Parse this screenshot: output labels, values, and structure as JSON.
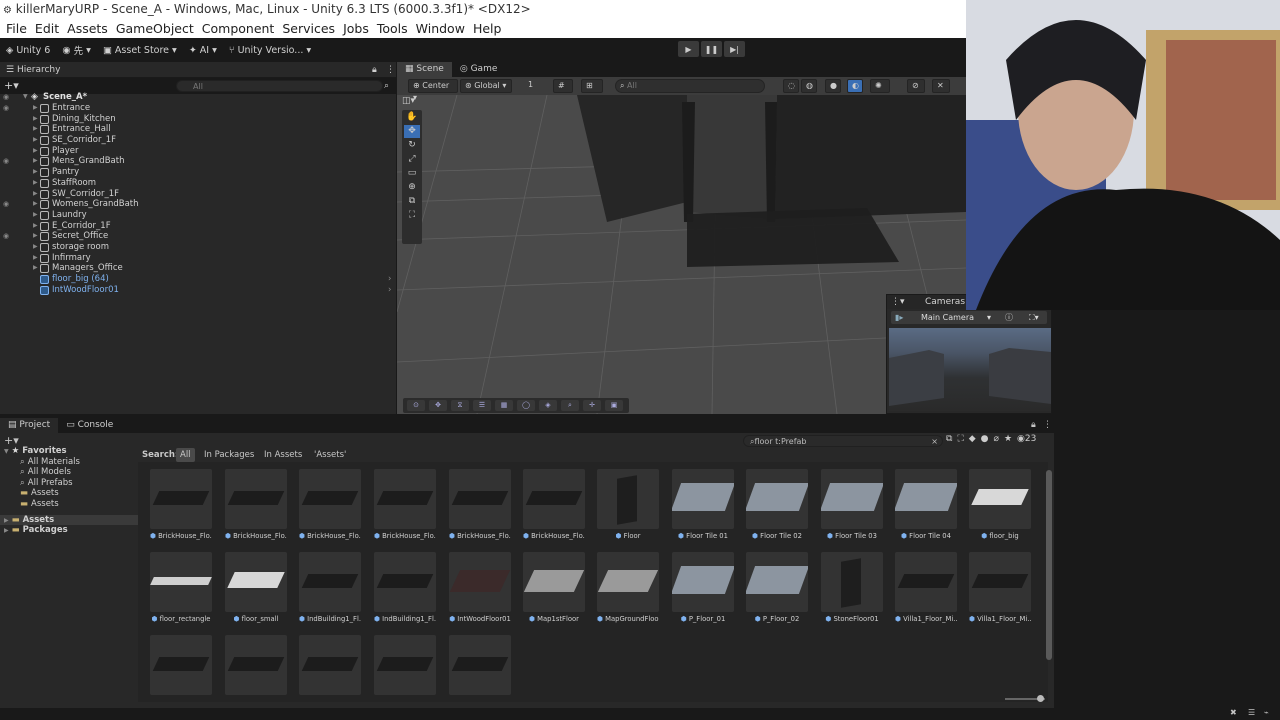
{
  "window": {
    "title": "killerMaryURP - Scene_A - Windows, Mac, Linux - Unity 6.3 LTS (6000.3.3f1)* <DX12>"
  },
  "menu": [
    "File",
    "Edit",
    "Assets",
    "GameObject",
    "Component",
    "Services",
    "Jobs",
    "Tools",
    "Window",
    "Help"
  ],
  "toolbar": {
    "unity_label": "Unity 6",
    "account_label": "先",
    "asset_store_label": "Asset Store",
    "ai_label": "AI",
    "version_label": "Unity Versio..."
  },
  "hierarchy": {
    "tab": "Hierarchy",
    "search_placeholder": "All",
    "scene_name": "Scene_A*",
    "items": [
      {
        "name": "Entrance",
        "type": "object"
      },
      {
        "name": "Dining_Kitchen",
        "type": "object"
      },
      {
        "name": "Entrance_Hall",
        "type": "object"
      },
      {
        "name": "SE_Corridor_1F",
        "type": "object"
      },
      {
        "name": "Player",
        "type": "object"
      },
      {
        "name": "Mens_GrandBath",
        "type": "object"
      },
      {
        "name": "Pantry",
        "type": "object"
      },
      {
        "name": "StaffRoom",
        "type": "object"
      },
      {
        "name": "SW_Corridor_1F",
        "type": "object"
      },
      {
        "name": "Womens_GrandBath",
        "type": "object"
      },
      {
        "name": "Laundry",
        "type": "object"
      },
      {
        "name": "E_Corridor_1F",
        "type": "object"
      },
      {
        "name": "Secret_Office",
        "type": "object"
      },
      {
        "name": "storage room",
        "type": "object"
      },
      {
        "name": "Infirmary",
        "type": "object"
      },
      {
        "name": "Managers_Office",
        "type": "object"
      },
      {
        "name": "floor_big (64)",
        "type": "prefab"
      },
      {
        "name": "IntWoodFloor01",
        "type": "prefab"
      }
    ]
  },
  "scene": {
    "tabs": [
      "Scene",
      "Game"
    ],
    "pivot_label": "Center",
    "space_label": "Global",
    "grid_value": "1",
    "search_placeholder": "All"
  },
  "cameras_overlay": {
    "title": "Cameras",
    "selected_camera": "Main Camera"
  },
  "project": {
    "tabs": [
      "Project",
      "Console"
    ],
    "search_value": "floor t:Prefab",
    "result_count": "23",
    "filters": {
      "label": "Search:",
      "all": "All",
      "in_packages": "In Packages",
      "in_assets": "In Assets",
      "assets_quoted": "'Assets'"
    },
    "tree": {
      "favorites": "Favorites",
      "favorite_items": [
        "All Materials",
        "All Models",
        "All Prefabs",
        "Assets",
        "Assets"
      ],
      "assets": "Assets",
      "packages": "Packages"
    },
    "assets": [
      {
        "label": "BrickHouse_Flo...",
        "thumb": "dark-slab"
      },
      {
        "label": "BrickHouse_Flo...",
        "thumb": "dark-slab"
      },
      {
        "label": "BrickHouse_Flo...",
        "thumb": "dark-slab"
      },
      {
        "label": "BrickHouse_Flo...",
        "thumb": "dark-slab"
      },
      {
        "label": "BrickHouse_Flo...",
        "thumb": "dark-slab"
      },
      {
        "label": "BrickHouse_Flo...",
        "thumb": "dark-slab"
      },
      {
        "label": "Floor",
        "thumb": "vertical-slab"
      },
      {
        "label": "Floor Tile 01",
        "thumb": "light-tile"
      },
      {
        "label": "Floor Tile 02",
        "thumb": "light-tile"
      },
      {
        "label": "Floor Tile 03",
        "thumb": "light-tile"
      },
      {
        "label": "Floor Tile 04",
        "thumb": "light-tile"
      },
      {
        "label": "floor_big",
        "thumb": "white-slab"
      },
      {
        "label": "floor_rectangle",
        "thumb": "white-strip"
      },
      {
        "label": "floor_small",
        "thumb": "white-slab"
      },
      {
        "label": "IndBuilding1_Fl...",
        "thumb": "dark-slab"
      },
      {
        "label": "IndBuilding1_Fl...",
        "thumb": "dark-slab"
      },
      {
        "label": "IntWoodFloor01",
        "thumb": "brown-slab"
      },
      {
        "label": "Map1stFloor",
        "thumb": "grey-slab"
      },
      {
        "label": "MapGroundFloor",
        "thumb": "grey-slab"
      },
      {
        "label": "P_Floor_01",
        "thumb": "light-tile"
      },
      {
        "label": "P_Floor_02",
        "thumb": "light-tile"
      },
      {
        "label": "StoneFloor01",
        "thumb": "vertical-slab"
      },
      {
        "label": "Villa1_Floor_Mi...",
        "thumb": "dark-slab"
      },
      {
        "label": "Villa1_Floor_Mi...",
        "thumb": "dark-slab"
      },
      {
        "label": "",
        "thumb": "dark-slab"
      },
      {
        "label": "",
        "thumb": "dark-slab"
      },
      {
        "label": "",
        "thumb": "dark-slab"
      },
      {
        "label": "",
        "thumb": "dark-slab"
      },
      {
        "label": "",
        "thumb": "dark-slab"
      }
    ]
  },
  "colors": {
    "prefab_blue": "#7fb2ef",
    "active_tool": "#3a6fb5",
    "panel_bg": "#282828"
  }
}
